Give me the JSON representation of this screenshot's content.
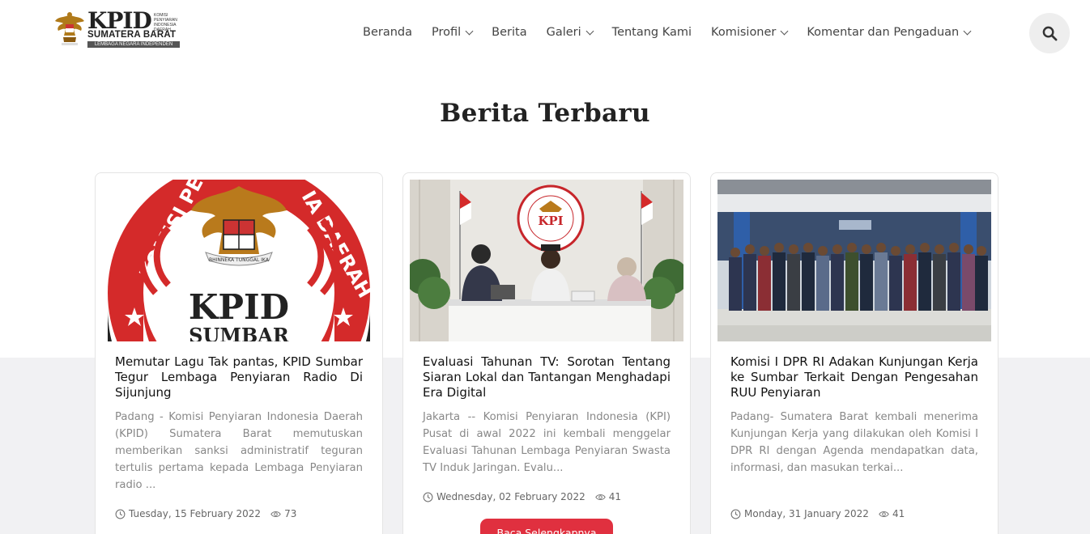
{
  "logo": {
    "name": "KPID",
    "small_text": "KOMISI PENYIARAN INDONESIA DAERAH",
    "region": "SUMATERA BARAT",
    "tagline": "LEMBAGA NEGARA INDEPENDEN"
  },
  "nav": {
    "items": [
      {
        "label": "Beranda",
        "dropdown": false
      },
      {
        "label": "Profil",
        "dropdown": true
      },
      {
        "label": "Berita",
        "dropdown": false
      },
      {
        "label": "Galeri",
        "dropdown": true
      },
      {
        "label": "Tentang Kami",
        "dropdown": false
      },
      {
        "label": "Komisioner",
        "dropdown": true
      },
      {
        "label": "Komentar dan Pengaduan",
        "dropdown": true
      }
    ],
    "search_icon": "search-icon"
  },
  "section": {
    "title": "Berita Terbaru"
  },
  "cards": [
    {
      "title": "Memutar Lagu Tak pantas, KPID Sumbar Tegur Lembaga Penyiaran Radio Di Sijunjung",
      "excerpt": "Padang - Komisi Penyiaran Indonesia Daerah (KPID) Sumatera Barat memutuskan memberikan sanksi administratif teguran tertulis pertama kepada Lembaga Penyiaran radio ...",
      "date": "Tuesday, 15 February 2022",
      "views": "73",
      "image_text": {
        "ring_left": "KOMISI PEN",
        "ring_right": "IA DAERAH",
        "center": "KPID",
        "bottom": "SUMBAR",
        "motto": "BHINNEKA TUNGGAL IKA"
      }
    },
    {
      "title": "Evaluasi Tahunan TV: Sorotan Tentang Siaran Lokal dan Tantangan Menghadapi Era Digital",
      "excerpt": "Jakarta -- Komisi Penyiaran Indonesia (KPI) Pusat di awal 2022 ini kembali menggelar Evaluasi Tahunan Lembaga Penyiaran Swasta TV Induk Jaringan. Evalu...",
      "date": "Wednesday, 02 February 2022",
      "views": "41",
      "button": "Baca Selengkapnya",
      "image_text": {
        "logo": "KPI"
      }
    },
    {
      "title": "Komisi I DPR RI Adakan Kunjungan Kerja ke Sumbar Terkait Dengan Pengesahan RUU Penyiaran",
      "excerpt": "Padang- Sumatera Barat kembali menerima Kunjungan Kerja yang dilakukan oleh Komisi I DPR RI dengan Agenda mendapatkan data, informasi, dan masukan terkai...",
      "date": "Monday, 31 January 2022",
      "views": "41"
    }
  ],
  "colors": {
    "accent": "#e0303f",
    "title_text": "#222222",
    "excerpt_text": "#888888",
    "band": "#f1f1f3"
  }
}
